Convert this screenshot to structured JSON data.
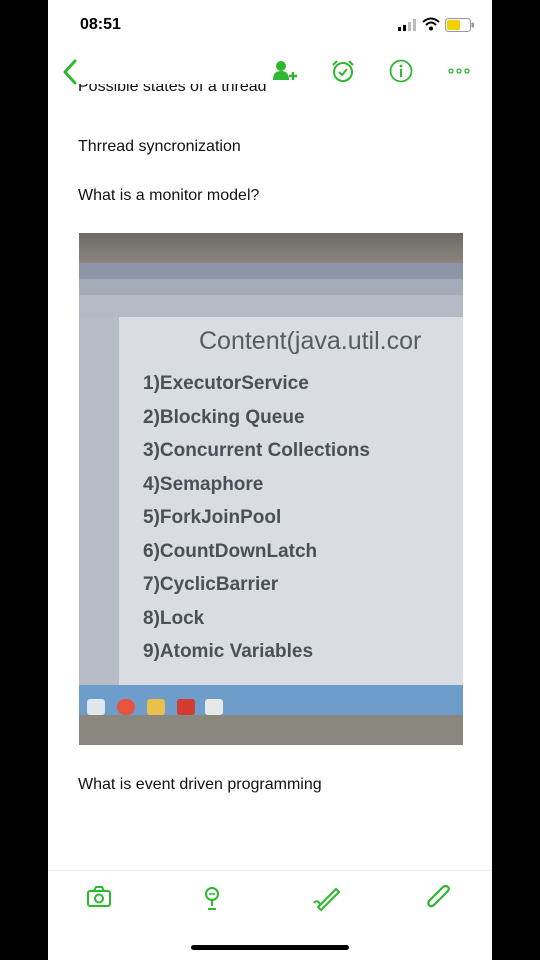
{
  "status_bar": {
    "time": "08:51"
  },
  "note": {
    "cut_off_line": "Possible states of a thread",
    "lines": [
      "Thrread syncronization",
      "What is a monitor model?"
    ],
    "after_image_line": "What is event driven programming"
  },
  "photo_slide": {
    "title": "Content(java.util.cor",
    "items": [
      "1)ExecutorService",
      "2)Blocking Queue",
      "3)Concurrent Collections",
      "4)Semaphore",
      "5)ForkJoinPool",
      "6)CountDownLatch",
      "7)CyclicBarrier",
      "8)Lock",
      "9)Atomic Variables"
    ]
  },
  "colors": {
    "accent": "#2db82d",
    "text": "#111111"
  },
  "icons": {
    "nav": [
      "back-chevron-icon",
      "add-user-icon",
      "alarm-icon",
      "info-icon",
      "more-icon"
    ],
    "toolbar": [
      "camera-icon",
      "microphone-icon",
      "pen-icon",
      "paperclip-icon"
    ]
  }
}
